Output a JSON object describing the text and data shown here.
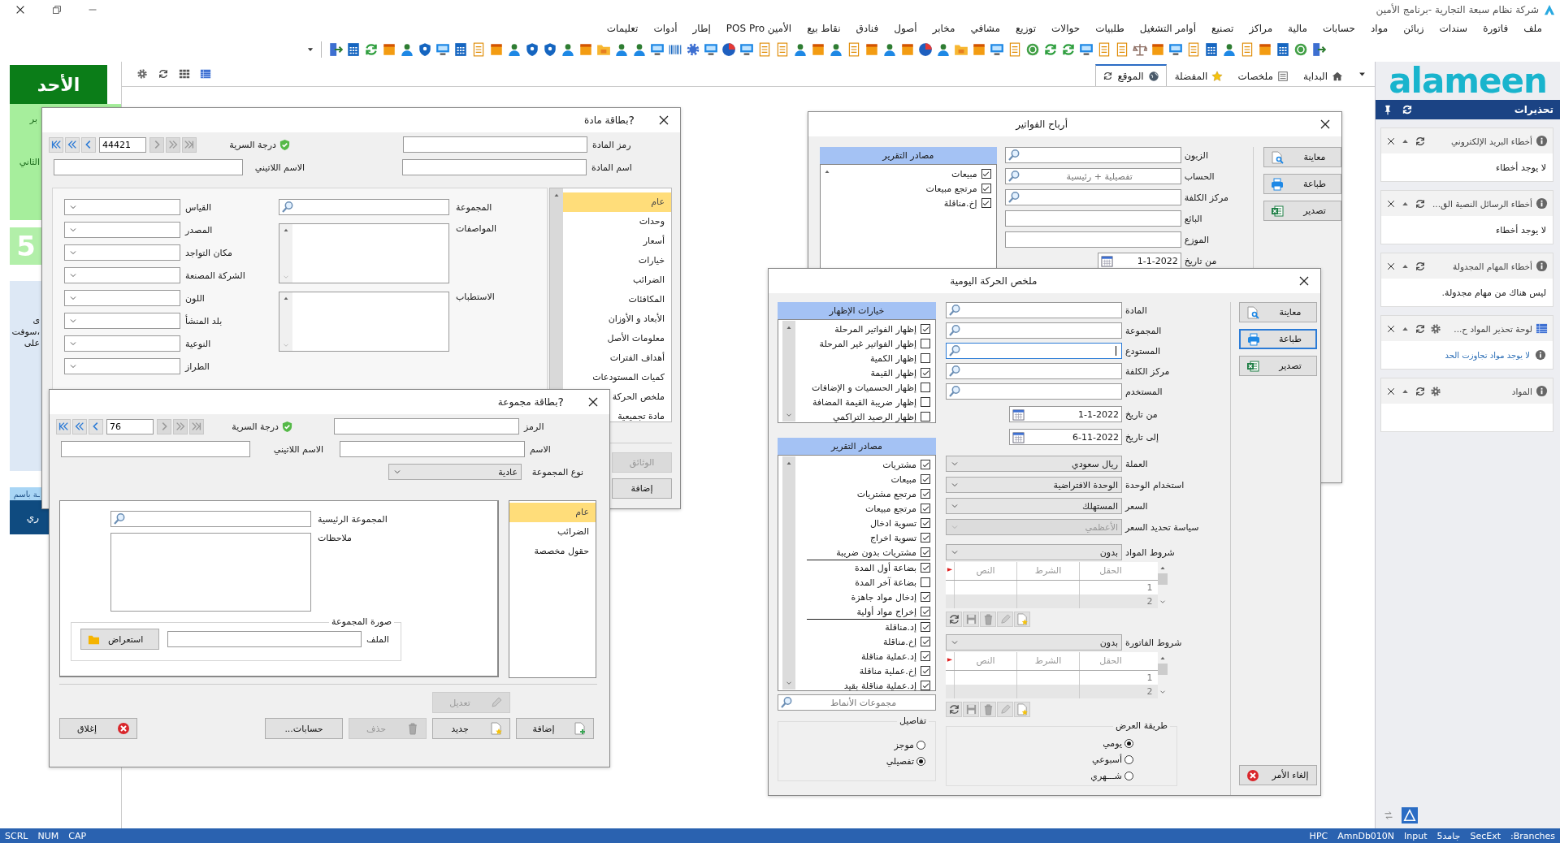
{
  "app_title": "شركة نظام سبعة التجارية -برنامج الأمين",
  "menu": [
    "ملف",
    "فاتورة",
    "سندات",
    "زبائن",
    "مواد",
    "حسابات",
    "مالية",
    "مراكز",
    "تصنيع",
    "أوامر التشغيل",
    "طلبيات",
    "حوالات",
    "توزيع",
    "مشافي",
    "مخابر",
    "أصول",
    "فنادق",
    "نقاط بيع",
    "الأمين POS Pro",
    "إطار",
    "أدوات",
    "تعليمات"
  ],
  "tabs": [
    {
      "label": "البداية",
      "selected": false,
      "kind": "home"
    },
    {
      "label": "ملخصات",
      "selected": false,
      "kind": "summary"
    },
    {
      "label": "المفضلة",
      "selected": false,
      "kind": "favorite"
    },
    {
      "label": "الموقع",
      "selected": true,
      "kind": "site"
    }
  ],
  "left_panel": {
    "day": "الأحد",
    "blocks": [
      {
        "kind": "light_green",
        "texts": [
          "بر",
          "الثاني"
        ]
      },
      {
        "kind": "green",
        "texts": [
          "5"
        ]
      },
      {
        "kind": "light_blue",
        "texts": [
          "ى",
          "سوفت،",
          "على"
        ]
      },
      {
        "kind": "caption",
        "texts": [
          "ـة باسم"
        ]
      },
      {
        "kind": "dark_blue",
        "texts": [
          "ري"
        ]
      }
    ]
  },
  "logo": "alameen",
  "alerts": {
    "title": "تحذيرات",
    "cards": [
      {
        "title": "أخطاء البريد الإلكتروني",
        "kind": "info",
        "settings": false,
        "message": "لا يوجد أخطاء"
      },
      {
        "title": "أخطاء الرسائل النصية الق...",
        "kind": "info",
        "settings": false,
        "message": "لا يوجد أخطاء"
      },
      {
        "title": "أخطاء المهام المجدولة",
        "kind": "info",
        "settings": false,
        "message": "ليس هناك من مهام مجدولة."
      },
      {
        "title": "لوحة تحذير المواد ح...",
        "kind": "table",
        "settings": true,
        "message": "لا يوجد مواد تجاوزت الحد"
      },
      {
        "title": "المواد",
        "kind": "info",
        "settings": true
      }
    ]
  },
  "material_card": {
    "title": "بطاقة مادة",
    "help": "?",
    "record": "44421",
    "prev_disabled": false,
    "next_disabled": true,
    "secrecy_label": "درجة السرية",
    "code_label": "رمز المادة",
    "name_label": "اسم المادة",
    "latin_name_label": "الاسم اللاتيني",
    "group_label": "المجموعة",
    "specs_label": "المواصفات",
    "indications_label": "الاستطباب",
    "combos": [
      "القياس",
      "المصدر",
      "مكان التواجد",
      "الشركة المصنعة",
      "اللون",
      "بلد المنشأ",
      "النوعية",
      "الطراز"
    ],
    "sections": [
      {
        "label": "عام",
        "selected": true
      },
      {
        "label": "وحدات",
        "selected": false
      },
      {
        "label": "أسعار",
        "selected": false
      },
      {
        "label": "خيارات",
        "selected": false
      },
      {
        "label": "الضرائب",
        "selected": false
      },
      {
        "label": "المكافئات",
        "selected": false
      },
      {
        "label": "الأبعاد و الأوزان",
        "selected": false
      },
      {
        "label": "معلومات الأصل",
        "selected": false
      },
      {
        "label": "أهداف الفترات",
        "selected": false
      },
      {
        "label": "كميات المستودعات",
        "selected": false
      },
      {
        "label": "ملخص الحركة",
        "selected": false
      },
      {
        "label": "مادة تجميعية",
        "selected": false
      }
    ],
    "buttons": [
      {
        "label": "الوثائق",
        "disabled": true
      },
      {
        "label": "إضافة",
        "disabled": false
      }
    ]
  },
  "group_card": {
    "title": "بطاقة مجموعة",
    "help": "?",
    "record": "76",
    "prev_disabled": false,
    "next_disabled": true,
    "secrecy_label": "درجة السرية",
    "code_label": "الرمز",
    "name_label": "الاسم",
    "latin_name_label": "الاسم اللاتيني",
    "type_label": "نوع المجموعة",
    "type_value": "عادية",
    "parent_label": "المجموعة الرئيسية",
    "notes_label": "ملاحظات",
    "image_title": "صورة المجموعة",
    "file_label": "الملف",
    "browse": "استعراض",
    "sections": [
      {
        "label": "عام",
        "selected": true
      },
      {
        "label": "الضرائب",
        "selected": false
      },
      {
        "label": "حقول مخصصة",
        "selected": false
      }
    ],
    "edit_button": {
      "label": "تعديل",
      "disabled": true
    },
    "buttons": [
      {
        "label": "إضافة",
        "kind": "add",
        "disabled": false
      },
      {
        "label": "جديد",
        "kind": "new",
        "disabled": false
      },
      {
        "label": "حذف",
        "kind": "delete",
        "disabled": true
      },
      {
        "label": "حسابات...",
        "kind": "plain",
        "disabled": false
      },
      {
        "label": "إغلاق",
        "kind": "close",
        "disabled": false
      }
    ]
  },
  "profits_report": {
    "title": "أرباح الفواتير",
    "sources_header": "مصادر التقرير",
    "sources": [
      {
        "label": "مبيعات",
        "checked": true
      },
      {
        "label": "مرتجع مبيعات",
        "checked": true
      },
      {
        "label": "إخ.مناقلة",
        "checked": true
      }
    ],
    "fields": [
      {
        "label": "الزبون",
        "search": true
      },
      {
        "label": "الحساب",
        "search": true,
        "placeholder": "تفصيلية + رئيسية"
      },
      {
        "label": "مركز الكلفة",
        "search": true
      },
      {
        "label": "البائع",
        "search": false
      },
      {
        "label": "الموزع",
        "search": false
      }
    ],
    "from_label": "من تاريخ",
    "from_value": "1-1-2022",
    "buttons": [
      {
        "label": "معاينة",
        "kind": "preview"
      },
      {
        "label": "طباعة",
        "kind": "print"
      },
      {
        "label": "تصدير",
        "kind": "export"
      }
    ]
  },
  "daily_summary": {
    "title": "ملخص الحركة اليومية",
    "options_header": "خيارات الإظهار",
    "options": [
      {
        "label": "إظهار الفواتير المرحلة",
        "checked": true
      },
      {
        "label": "إظهار الفواتير غير المرحلة",
        "checked": false
      },
      {
        "label": "إظهار الكمية",
        "checked": false
      },
      {
        "label": "إظهار القيمة",
        "checked": true
      },
      {
        "label": "إظهار الحسميات و الإضافات",
        "checked": false
      },
      {
        "label": "إظهار ضريبة القيمة المضافة",
        "checked": false
      },
      {
        "label": "إظهار الرصيد التراكمي",
        "checked": false
      }
    ],
    "sources_header": "مصادر التقرير",
    "source_groups": [
      [
        {
          "label": "مشتريات",
          "checked": true
        },
        {
          "label": "مبيعات",
          "checked": true
        },
        {
          "label": "مرتجع مشتريات",
          "checked": true
        },
        {
          "label": "مرتجع مبيعات",
          "checked": true
        },
        {
          "label": "تسوية ادخال",
          "checked": true
        },
        {
          "label": "تسوية اخراج",
          "checked": true
        },
        {
          "label": "مشتريات بدون ضريبة",
          "checked": true
        }
      ],
      [
        {
          "label": "بضاعة أول المدة",
          "checked": true
        },
        {
          "label": "بضاعة آخر المدة",
          "checked": false
        },
        {
          "label": "إدخال مواد جاهزة",
          "checked": true
        },
        {
          "label": "إخراج مواد أولية",
          "checked": true
        }
      ],
      [
        {
          "label": "إد.مناقلة",
          "checked": true
        },
        {
          "label": "إخ.مناقلة",
          "checked": true
        },
        {
          "label": "إد.عملية مناقلة",
          "checked": true
        },
        {
          "label": "إخ.عملية مناقلة",
          "checked": true
        },
        {
          "label": "إد.عملية مناقلة بقيد",
          "checked": true
        }
      ]
    ],
    "patterns_placeholder": "مجموعات الأنماط",
    "details": {
      "title": "تفاصيل",
      "options": [
        {
          "label": "موجز",
          "selected": false
        },
        {
          "label": "تفصيلي",
          "selected": true
        }
      ]
    },
    "fields": [
      {
        "label": "المادة",
        "focused": false
      },
      {
        "label": "المجموعة",
        "focused": false
      },
      {
        "label": "المستودع",
        "focused": true
      },
      {
        "label": "مركز الكلفة",
        "focused": false
      },
      {
        "label": "المستخدم",
        "focused": false
      }
    ],
    "dates": [
      {
        "label": "من تاريخ",
        "value": "1-1-2022"
      },
      {
        "label": "إلى تاريخ",
        "value": "6-11-2022"
      }
    ],
    "combos": [
      {
        "label": "العملة",
        "value": "ريال سعودي",
        "disabled": false
      },
      {
        "label": "استخدام الوحدة",
        "value": "الوحدة الافتراضية",
        "disabled": false
      },
      {
        "label": "السعر",
        "value": "المستهلك",
        "disabled": false
      },
      {
        "label": "سياسة تحديد السعر",
        "value": "الأعظمي",
        "disabled": true
      }
    ],
    "conditions": [
      {
        "label": "شروط المواد",
        "value": "بدون",
        "columns": [
          "الحقل",
          "الشرط",
          "النص"
        ],
        "rows": [
          "1",
          "2"
        ]
      },
      {
        "label": "شروط الفاتورة",
        "value": "بدون",
        "columns": [
          "الحقل",
          "الشرط",
          "النص"
        ],
        "rows": [
          "1",
          "2"
        ]
      }
    ],
    "display": {
      "title": "طريقة العرض",
      "options": [
        {
          "label": "يومي",
          "selected": true
        },
        {
          "label": "أسبوعي",
          "selected": false
        },
        {
          "label": "شـــهري",
          "selected": false
        }
      ]
    },
    "buttons": [
      {
        "label": "معاينة",
        "kind": "preview",
        "focused": false
      },
      {
        "label": "طباعة",
        "kind": "print",
        "focused": true
      },
      {
        "label": "تصدير",
        "kind": "export",
        "focused": false
      }
    ],
    "cancel": "إلغاء الأمر"
  },
  "status_bar": {
    "left": [
      "CAP",
      "NUM",
      "SCRL"
    ],
    "right": [
      ":Branches",
      "SecExt",
      "جامد5",
      "Input",
      "AmnDb010N",
      "HPC"
    ]
  }
}
